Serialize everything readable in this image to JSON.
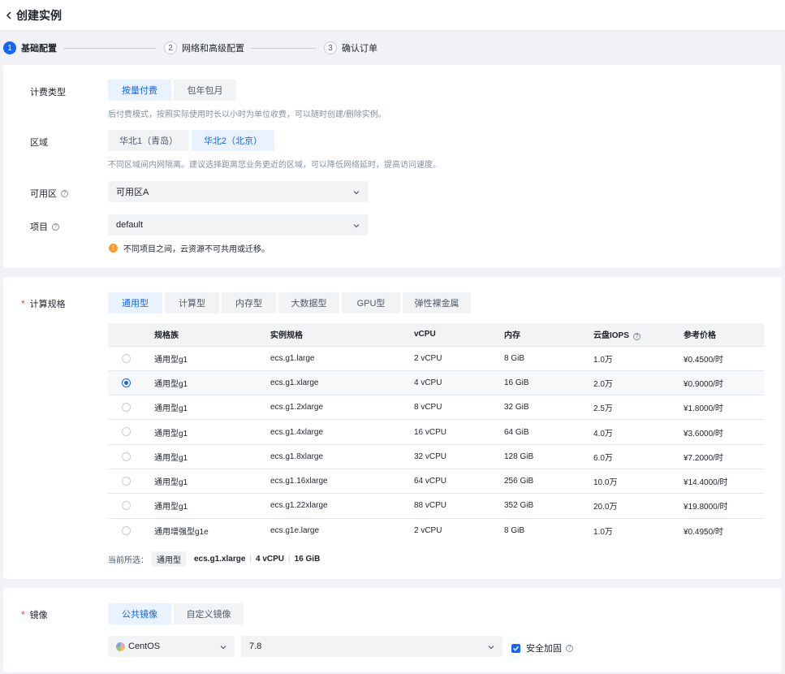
{
  "header": {
    "title": "创建实例"
  },
  "steps": [
    {
      "num": "1",
      "label": "基础配置"
    },
    {
      "num": "2",
      "label": "网络和高级配置"
    },
    {
      "num": "3",
      "label": "确认订单"
    }
  ],
  "billing": {
    "label": "计费类型",
    "options": [
      "按量付费",
      "包年包月"
    ],
    "hint": "后付费模式，按照实际使用时长以小时为单位收费，可以随时创建/删除实例。"
  },
  "region": {
    "label": "区域",
    "options": [
      "华北1（青岛）",
      "华北2（北京）"
    ],
    "hint": "不同区域间内网隔离。建议选择距离您业务更近的区域，可以降低网络延时，提高访问速度。"
  },
  "zone": {
    "label": "可用区",
    "help": "?",
    "value": "可用区A"
  },
  "project": {
    "label": "项目",
    "help": "?",
    "value": "default",
    "warning_icon": "!",
    "warning": "不同项目之间，云资源不可共用或迁移。"
  },
  "spec": {
    "required": "*",
    "label": "计算规格",
    "tabs": [
      "通用型",
      "计算型",
      "内存型",
      "大数据型",
      "GPU型",
      "弹性裸金属"
    ],
    "columns": [
      "规格族",
      "实例规格",
      "vCPU",
      "内存",
      "云盘IOPS",
      "参考价格"
    ],
    "iops_help": "?",
    "rows": [
      [
        "通用型g1",
        "ecs.g1.large",
        "2 vCPU",
        "8 GiB",
        "1.0万",
        "¥0.4500/时"
      ],
      [
        "通用型g1",
        "ecs.g1.xlarge",
        "4 vCPU",
        "16 GiB",
        "2.0万",
        "¥0.9000/时"
      ],
      [
        "通用型g1",
        "ecs.g1.2xlarge",
        "8 vCPU",
        "32 GiB",
        "2.5万",
        "¥1.8000/时"
      ],
      [
        "通用型g1",
        "ecs.g1.4xlarge",
        "16 vCPU",
        "64 GiB",
        "4.0万",
        "¥3.6000/时"
      ],
      [
        "通用型g1",
        "ecs.g1.8xlarge",
        "32 vCPU",
        "128 GiB",
        "6.0万",
        "¥7.2000/时"
      ],
      [
        "通用型g1",
        "ecs.g1.16xlarge",
        "64 vCPU",
        "256 GiB",
        "10.0万",
        "¥14.4000/时"
      ],
      [
        "通用型g1",
        "ecs.g1.22xlarge",
        "88 vCPU",
        "352 GiB",
        "20.0万",
        "¥19.8000/时"
      ],
      [
        "通用增强型g1e",
        "ecs.g1e.large",
        "2 vCPU",
        "8 GiB",
        "1.0万",
        "¥0.4950/时"
      ]
    ],
    "selected_index": 1,
    "current": {
      "label": "当前所选：",
      "tag": "通用型",
      "spec": "ecs.g1.xlarge",
      "sep": "|",
      "vcpu": "4 vCPU",
      "memory": "16 GiB"
    }
  },
  "image": {
    "required": "*",
    "label": "镜像",
    "tabs": [
      "公共镜像",
      "自定义镜像"
    ],
    "os": "CentOS",
    "version": "7.8",
    "hardening_label": "安全加固",
    "hardening_help": "?"
  },
  "colors": {
    "primary": "#1664ff",
    "warning": "#ff9a2e",
    "required": "#f53f3f"
  }
}
